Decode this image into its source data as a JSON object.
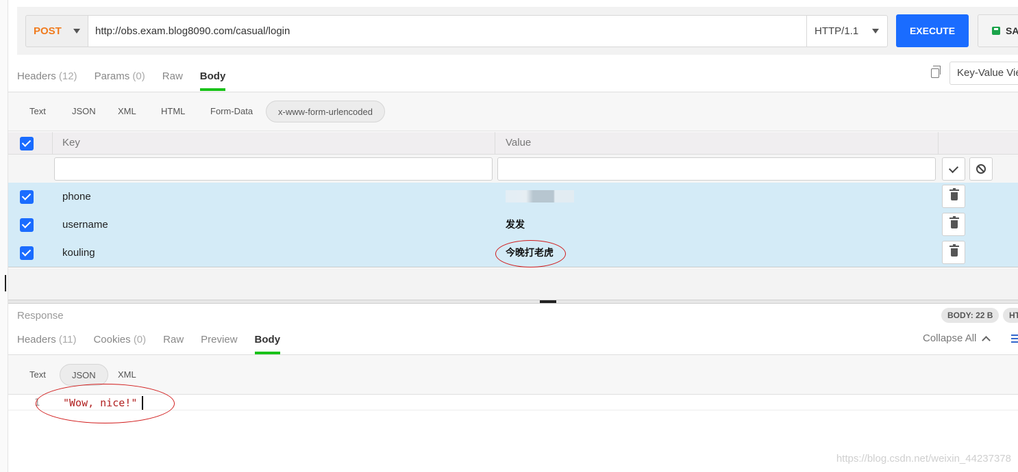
{
  "request": {
    "method": "POST",
    "url": "http://obs.exam.blog8090.com/casual/login",
    "http_version": "HTTP/1.1",
    "execute_label": "EXECUTE",
    "save_label": "SA",
    "tabs": [
      {
        "label": "Headers",
        "count": "(12)"
      },
      {
        "label": "Params",
        "count": "(0)"
      },
      {
        "label": "Raw",
        "count": ""
      },
      {
        "label": "Body",
        "count": ""
      }
    ],
    "active_tab": "Body",
    "view_mode": "Key-Value Vie",
    "body_formats": [
      "Text",
      "JSON",
      "XML",
      "HTML",
      "Form-Data",
      "x-www-form-urlencoded"
    ],
    "active_body_format": "x-www-form-urlencoded",
    "table": {
      "columns": [
        "Key",
        "Value"
      ],
      "rows": [
        {
          "key": "phone",
          "value": "",
          "checked": true,
          "value_masked": true
        },
        {
          "key": "username",
          "value": "发发",
          "checked": true
        },
        {
          "key": "kouling",
          "value": "今晚打老虎",
          "checked": true
        }
      ]
    }
  },
  "response": {
    "label": "Response",
    "badges": [
      "BODY: 22 B",
      "HT"
    ],
    "tabs": [
      {
        "label": "Headers",
        "count": "(11)"
      },
      {
        "label": "Cookies",
        "count": "(0)"
      },
      {
        "label": "Raw",
        "count": ""
      },
      {
        "label": "Preview",
        "count": ""
      },
      {
        "label": "Body",
        "count": ""
      }
    ],
    "active_tab": "Body",
    "collapse_all_label": "Collapse All",
    "formats": [
      "Text",
      "JSON",
      "XML"
    ],
    "active_format": "JSON",
    "lines": [
      {
        "number": "1",
        "text": "\"Wow, nice!\""
      }
    ]
  },
  "watermark": "https://blog.csdn.net/weixin_44237378",
  "colors": {
    "accent": "#1a6cff",
    "method": "#f07b1e",
    "active_tab_underline": "#1ac21a",
    "selected_rows": "#d4ebf7",
    "annotation": "#d11a1a",
    "json_string": "#b01e1e"
  },
  "icons": [
    "chevron-down-icon",
    "save-icon",
    "copy-icon",
    "check-icon",
    "ban-icon",
    "trash-icon",
    "chevron-up-icon",
    "wrap-lines-icon"
  ]
}
